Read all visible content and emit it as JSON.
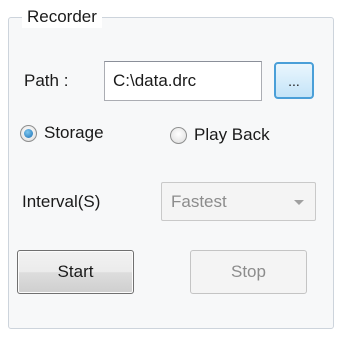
{
  "recorder": {
    "title": "Recorder",
    "path_label": "Path :",
    "path_value": "C:\\data.drc",
    "browse_label": "...",
    "mode": {
      "options": [
        "Storage",
        "Play Back"
      ],
      "selected": "Storage"
    },
    "interval_label": "Interval(S)",
    "interval_value": "Fastest",
    "interval_enabled": false,
    "start_label": "Start",
    "stop_label": "Stop",
    "stop_enabled": false
  }
}
